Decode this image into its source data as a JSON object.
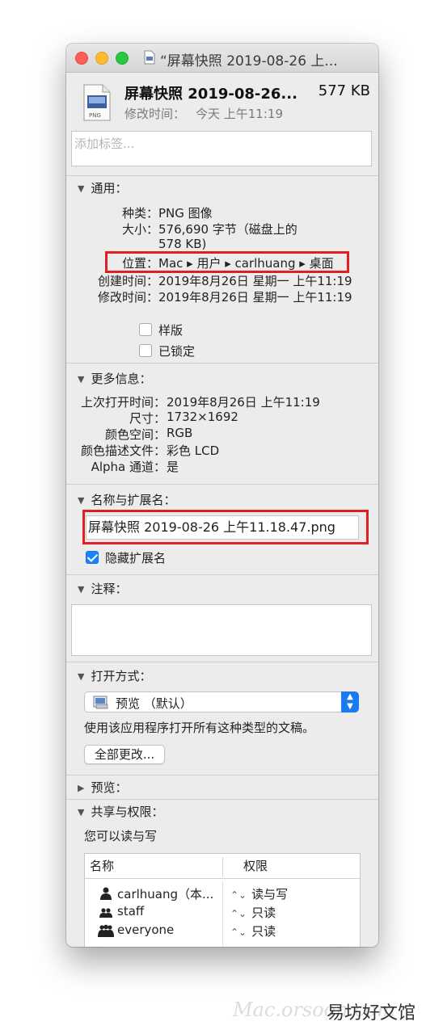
{
  "window": {
    "title": "“屏幕快照 2019-08-26 上...",
    "file_name": "屏幕快照 2019-08-26...",
    "file_size": "577 KB",
    "modified_label": "修改时间：",
    "modified_value": "今天 上午11:19",
    "tags_placeholder": "添加标签..."
  },
  "general": {
    "heading": "通用：",
    "kind_label": "种类：",
    "kind_value": "PNG 图像",
    "size_label": "大小：",
    "size_value_line1": "576,690 字节（磁盘上的",
    "size_value_line2": "578 KB)",
    "where_label": "位置：",
    "where_value": "Mac ▸ 用户 ▸ carlhuang ▸ 桌面",
    "created_label": "创建时间：",
    "created_value": "2019年8月26日 星期一 上午11:19",
    "modified_label": "修改时间：",
    "modified_value": "2019年8月26日 星期一 上午11:19",
    "stationery_label": "样版",
    "locked_label": "已锁定",
    "stationery_checked": false,
    "locked_checked": false
  },
  "more_info": {
    "heading": "更多信息：",
    "last_opened_label": "上次打开时间：",
    "last_opened_value": "2019年8月26日 上午11:19",
    "dimensions_label": "尺寸：",
    "dimensions_value": "1732×1692",
    "color_space_label": "颜色空间：",
    "color_space_value": "RGB",
    "color_profile_label": "颜色描述文件：",
    "color_profile_value": "彩色 LCD",
    "alpha_label": "Alpha 通道：",
    "alpha_value": "是"
  },
  "name_ext": {
    "heading": "名称与扩展名：",
    "name_value": "屏幕快照 2019-08-26 上午11.18.47.png",
    "hide_ext_label": "隐藏扩展名",
    "hide_ext_checked": true
  },
  "comments": {
    "heading": "注释："
  },
  "open_with": {
    "heading": "打开方式：",
    "app_value": "预览 （默认）",
    "description": "使用该应用程序打开所有这种类型的文稿。",
    "change_all_label": "全部更改..."
  },
  "preview": {
    "heading": "预览："
  },
  "sharing": {
    "heading": "共享与权限：",
    "summary": "您可以读与写",
    "col_name": "名称",
    "col_priv": "权限",
    "rows": [
      {
        "name": "carlhuang（本...",
        "priv": "读与写",
        "icon": "user-icon"
      },
      {
        "name": "staff",
        "priv": "只读",
        "icon": "group-icon"
      },
      {
        "name": "everyone",
        "priv": "只读",
        "icon": "everyone-icon"
      }
    ]
  },
  "watermark": {
    "site": "Mac.orsoon.com",
    "brand": "易坊好文馆"
  },
  "colors": {
    "highlight_red": "#e02020",
    "accent_blue": "#1a82fb"
  }
}
